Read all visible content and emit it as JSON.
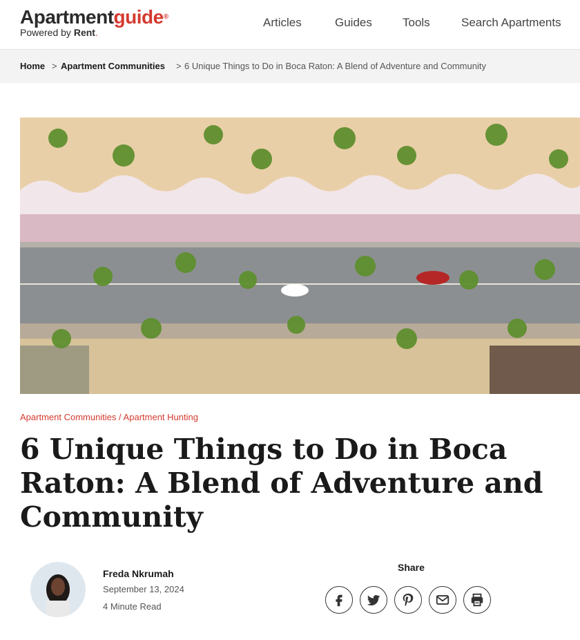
{
  "header": {
    "logo": {
      "main_a": "Apartment",
      "main_b": "guide",
      "registered": "®",
      "sub": "Powered by ",
      "sub_brand": "Rent",
      "sub_dot": "."
    },
    "nav": [
      "Articles",
      "Guides",
      "Tools",
      "Search Apartments"
    ]
  },
  "breadcrumb": {
    "items": [
      "Home",
      "Apartment Communities",
      "6 Unique Things to Do in Boca Raton: A Blend of Adventure and Community"
    ],
    "separator": ">"
  },
  "article": {
    "categories": "Apartment Communities / Apartment Hunting",
    "title": "6 Unique Things to Do in Boca Raton: A Blend of Adventure and Community",
    "author": {
      "name": "Freda Nkrumah",
      "date": "September 13, 2024",
      "read_time": "4 Minute Read"
    },
    "share": {
      "label": "Share",
      "icons": [
        "facebook-icon",
        "twitter-icon",
        "pinterest-icon",
        "email-icon",
        "print-icon"
      ]
    }
  },
  "colors": {
    "brand_red": "#d43a2f",
    "breadcrumb_bg": "#f3f3f3",
    "text": "#1a1a1a"
  }
}
